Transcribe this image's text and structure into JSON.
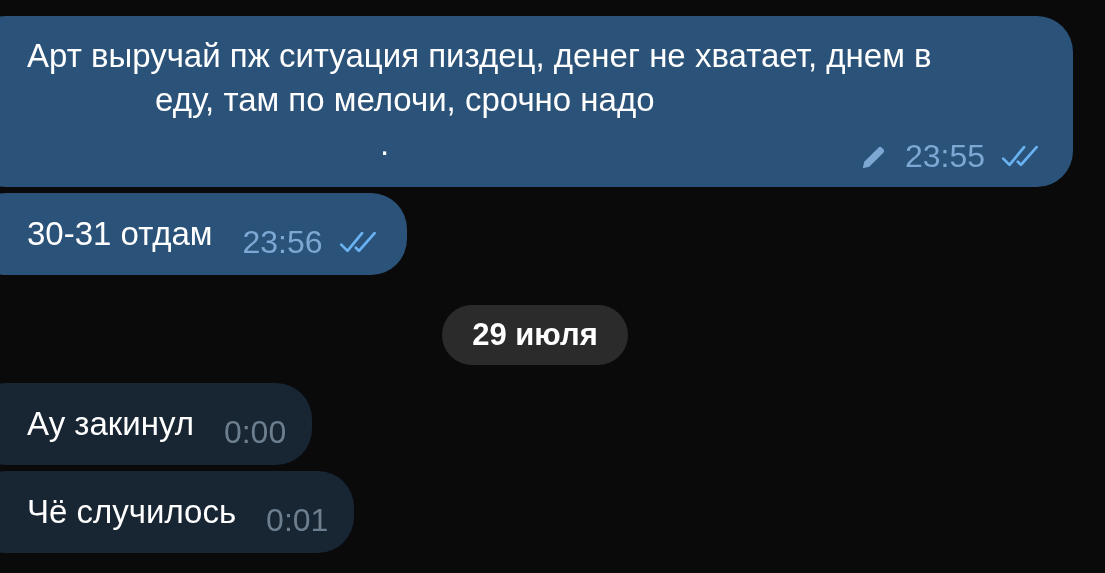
{
  "items": [
    {
      "kind": "message",
      "outgoing": true,
      "lines": [
        "Арт выручай пж ситуация пиздец, денег не хватает, днем в",
        "еду, там по мелочи, срочно надо",
        "."
      ],
      "edited": true,
      "time": "23:55",
      "read": true
    },
    {
      "kind": "message",
      "outgoing": true,
      "lines": [
        "30-31 отдам"
      ],
      "edited": false,
      "time": "23:56",
      "read": true
    },
    {
      "kind": "date",
      "label": "29 июля"
    },
    {
      "kind": "message",
      "outgoing": false,
      "lines": [
        "Ау закинул"
      ],
      "edited": false,
      "time": "0:00",
      "read": false
    },
    {
      "kind": "message",
      "outgoing": false,
      "lines": [
        "Чё случилось"
      ],
      "edited": false,
      "time": "0:01",
      "read": false
    }
  ]
}
